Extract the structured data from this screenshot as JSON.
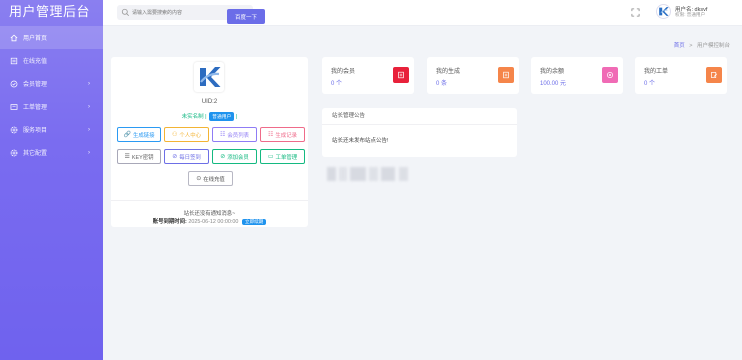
{
  "sidebar": {
    "title": "用户管理后台",
    "items": [
      {
        "label": "用户首页",
        "icon": "home-icon",
        "arrow": false,
        "active": true
      },
      {
        "label": "在线充值",
        "icon": "list-icon",
        "arrow": false,
        "active": false
      },
      {
        "label": "会员管理",
        "icon": "check-circle-icon",
        "arrow": true,
        "active": false
      },
      {
        "label": "工单管理",
        "icon": "ticket-icon",
        "arrow": true,
        "active": false
      },
      {
        "label": "服务项目",
        "icon": "gear-icon",
        "arrow": true,
        "active": false
      },
      {
        "label": "其它配置",
        "icon": "gear-icon",
        "arrow": true,
        "active": false
      }
    ]
  },
  "topbar": {
    "search_placeholder": "请输入需要搜索的内容",
    "search_button": "百度一下",
    "user_name": "用户名: dksvf",
    "user_role": "权限: 普通用户"
  },
  "breadcrumb": {
    "home": "首页",
    "sep": ">",
    "current": "用户模控制台"
  },
  "profile": {
    "uid": "UID:2",
    "status": "未实名制 |",
    "vip_badge": "普通用户",
    "status_tail": "|",
    "buttons": [
      {
        "label": "生成链接",
        "icon": "🔗",
        "color": "#2b9af3"
      },
      {
        "label": "个人中心",
        "icon": "⚇",
        "color": "#f3b434"
      },
      {
        "label": "会员列表",
        "icon": "☷",
        "color": "#8f7cf5"
      },
      {
        "label": "生成记录",
        "icon": "☷",
        "color": "#ef6b8a"
      },
      {
        "label": "KEY密钥",
        "icon": "☰",
        "color": "#8a8a9a"
      },
      {
        "label": "每日签到",
        "icon": "⊘",
        "color": "#6d6fe6"
      },
      {
        "label": "添加会员",
        "icon": "⊘",
        "color": "#14b981"
      },
      {
        "label": "工单管理",
        "icon": "▭",
        "color": "#14b981"
      },
      {
        "label": "在线充值",
        "icon": "⊙",
        "color": "#777780"
      }
    ],
    "notice": "站长还没有通知消息~",
    "expiry_label": "账号到期时间:",
    "expiry_value": "2025-06-12 00:00:00",
    "renew": "立即续期"
  },
  "stats": [
    {
      "label": "我的会员",
      "value": "0 个",
      "color": "#e8213b"
    },
    {
      "label": "我的生成",
      "value": "0 条",
      "color": "#f5854a"
    },
    {
      "label": "我的余额",
      "value": "100.00 元",
      "color": "#f06bb5"
    },
    {
      "label": "我的工单",
      "value": "0 个",
      "color": "#f5854a"
    }
  ],
  "announcement": {
    "title": "站长管理公告",
    "body": "站长还未发布站点公告!"
  }
}
